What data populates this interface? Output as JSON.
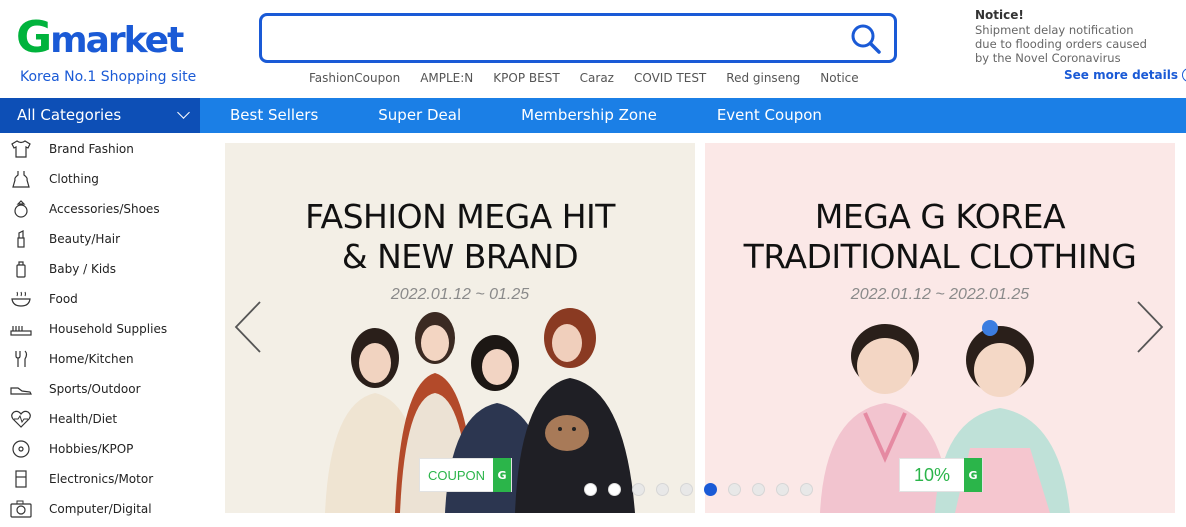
{
  "header": {
    "logo_g": "G",
    "logo_rest": "market",
    "tagline": "Korea No.1 Shopping site",
    "search": {
      "value": "",
      "placeholder": ""
    },
    "keywords": [
      "FashionCoupon",
      "AMPLE:N",
      "KPOP BEST",
      "Caraz",
      "COVID TEST",
      "Red ginseng",
      "Notice"
    ],
    "notice": {
      "title": "Notice!",
      "lines": [
        "Shipment delay notification",
        "due to flooding orders caused",
        "by the Novel Coronavirus"
      ],
      "more": "See more details"
    }
  },
  "nav": {
    "all_categories": "All Categories",
    "items": [
      "Best Sellers",
      "Super Deal",
      "Membership Zone",
      "Event Coupon"
    ]
  },
  "sidebar": {
    "items": [
      {
        "label": "Brand Fashion",
        "icon": "shirt-icon"
      },
      {
        "label": "Clothing",
        "icon": "dress-icon"
      },
      {
        "label": "Accessories/Shoes",
        "icon": "ring-icon"
      },
      {
        "label": "Beauty/Hair",
        "icon": "lipstick-icon"
      },
      {
        "label": "Baby / Kids",
        "icon": "baby-bottle-icon"
      },
      {
        "label": "Food",
        "icon": "bowl-icon"
      },
      {
        "label": "Household Supplies",
        "icon": "toothbrush-icon"
      },
      {
        "label": "Home/Kitchen",
        "icon": "utensils-icon"
      },
      {
        "label": "Sports/Outdoor",
        "icon": "sneaker-icon"
      },
      {
        "label": "Health/Diet",
        "icon": "heart-pulse-icon"
      },
      {
        "label": "Hobbies/KPOP",
        "icon": "record-icon"
      },
      {
        "label": "Electronics/Motor",
        "icon": "appliance-icon"
      },
      {
        "label": "Computer/Digital",
        "icon": "camera-icon"
      }
    ]
  },
  "banners": [
    {
      "title_line1": "FASHION MEGA HIT",
      "title_line2": "& NEW BRAND",
      "date": "2022.01.12 ~ 01.25",
      "badge": "COUPON",
      "badge_g": "G"
    },
    {
      "title_line1": "MEGA G KOREA",
      "title_line2": "TRADITIONAL CLOTHING",
      "date": "2022.01.12 ~ 2022.01.25",
      "badge": "10%",
      "badge_g": "G"
    }
  ],
  "carousel": {
    "dot_count": 10,
    "active_index": 5
  },
  "colors": {
    "brand_blue": "#1a5ad6",
    "nav_blue": "#1b7fe6",
    "category_dark": "#0d4fb6",
    "green": "#2bb54a"
  }
}
